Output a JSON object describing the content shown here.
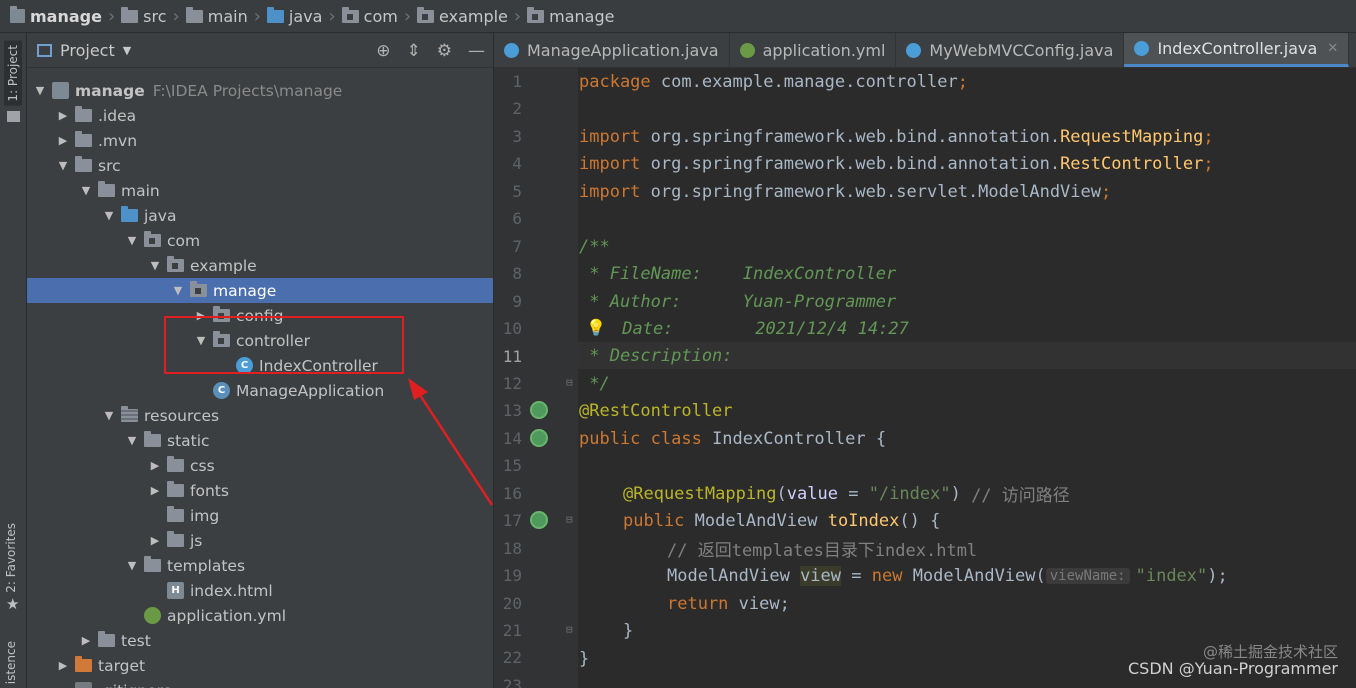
{
  "breadcrumb": [
    "manage",
    "src",
    "main",
    "java",
    "com",
    "example",
    "manage"
  ],
  "toolstrip": {
    "project_tab": "1: Project",
    "favorites_tab": "2: Favorites",
    "persistence_tab": "istence"
  },
  "project_panel": {
    "title": "Project",
    "tree": [
      {
        "label": "manage",
        "extra": "F:\\IDEA Projects\\manage",
        "depth": 0,
        "kind": "module",
        "arrow": "down"
      },
      {
        "label": ".idea",
        "depth": 1,
        "kind": "folder",
        "arrow": "right"
      },
      {
        "label": ".mvn",
        "depth": 1,
        "kind": "folder",
        "arrow": "right"
      },
      {
        "label": "src",
        "depth": 1,
        "kind": "folder",
        "arrow": "down"
      },
      {
        "label": "main",
        "depth": 2,
        "kind": "folder",
        "arrow": "down"
      },
      {
        "label": "java",
        "depth": 3,
        "kind": "folder-blue",
        "arrow": "down"
      },
      {
        "label": "com",
        "depth": 4,
        "kind": "package",
        "arrow": "down"
      },
      {
        "label": "example",
        "depth": 5,
        "kind": "package",
        "arrow": "down"
      },
      {
        "label": "manage",
        "depth": 6,
        "kind": "package",
        "arrow": "down",
        "selected": true
      },
      {
        "label": "config",
        "depth": 7,
        "kind": "package",
        "arrow": "right"
      },
      {
        "label": "controller",
        "depth": 7,
        "kind": "package",
        "arrow": "down"
      },
      {
        "label": "IndexController",
        "depth": 8,
        "kind": "class",
        "arrow": ""
      },
      {
        "label": "ManageApplication",
        "depth": 7,
        "kind": "spring-class",
        "arrow": ""
      },
      {
        "label": "resources",
        "depth": 3,
        "kind": "folder-res",
        "arrow": "down"
      },
      {
        "label": "static",
        "depth": 4,
        "kind": "folder",
        "arrow": "down"
      },
      {
        "label": "css",
        "depth": 5,
        "kind": "folder",
        "arrow": "right"
      },
      {
        "label": "fonts",
        "depth": 5,
        "kind": "folder",
        "arrow": "right"
      },
      {
        "label": "img",
        "depth": 5,
        "kind": "folder",
        "arrow": ""
      },
      {
        "label": "js",
        "depth": 5,
        "kind": "folder",
        "arrow": "right"
      },
      {
        "label": "templates",
        "depth": 4,
        "kind": "folder",
        "arrow": "down"
      },
      {
        "label": "index.html",
        "depth": 5,
        "kind": "html",
        "arrow": ""
      },
      {
        "label": "application.yml",
        "depth": 4,
        "kind": "yml",
        "arrow": ""
      },
      {
        "label": "test",
        "depth": 2,
        "kind": "folder",
        "arrow": "right"
      },
      {
        "label": "target",
        "depth": 1,
        "kind": "folder-orange",
        "arrow": "right"
      },
      {
        "label": ".gitignore",
        "depth": 1,
        "kind": "git",
        "arrow": ""
      }
    ]
  },
  "tabs": [
    {
      "label": "ManageApplication.java",
      "icon": "spring-class",
      "active": false
    },
    {
      "label": "application.yml",
      "icon": "yml",
      "active": false
    },
    {
      "label": "MyWebMVCConfig.java",
      "icon": "class",
      "active": false
    },
    {
      "label": "IndexController.java",
      "icon": "class",
      "active": true
    }
  ],
  "editor": {
    "current_line": 11,
    "line_numbers": [
      "1",
      "2",
      "3",
      "4",
      "5",
      "6",
      "7",
      "8",
      "9",
      "10",
      "11",
      "12",
      "13",
      "14",
      "15",
      "16",
      "17",
      "18",
      "19",
      "20",
      "21",
      "22",
      "23"
    ],
    "code": {
      "l1_kw": "package",
      "l1_rest": " com.example.manage.controller",
      "l1_semi": ";",
      "l3_kw": "import",
      "l3_pkg": " org.springframework.web.bind.annotation.",
      "l3_cls": "RequestMapping",
      "l3_semi": ";",
      "l4_kw": "import",
      "l4_pkg": " org.springframework.web.bind.annotation.",
      "l4_cls": "RestController",
      "l4_semi": ";",
      "l5_kw": "import",
      "l5_pkg": " org.springframework.web.servlet.ModelAndView",
      "l5_semi": ";",
      "l7": "/**",
      "l8": " * FileName:    IndexController",
      "l9": " * Author:      Yuan-Programmer",
      "l10": " Date:        2021/12/4 14:27",
      "l11": " * Description:",
      "l12": " */",
      "l13": "@RestController",
      "l14_kw": "public class",
      "l14_rest": " IndexController {",
      "l16_ann": "@RequestMapping",
      "l16_a": "(",
      "l16_param": "value",
      "l16_b": " = ",
      "l16_str": "\"/index\"",
      "l16_c": ") ",
      "l16_cmt": "// 访问路径",
      "l17_kw": "public",
      "l17_type": " ModelAndView ",
      "l17_fn": "toIndex",
      "l17_rest": "() {",
      "l18_cmt": "// 返回templates目录下index.html",
      "l19_type": "ModelAndView ",
      "l19_var": "view",
      "l19_eq": " = ",
      "l19_kw": "new",
      "l19_ctor": " ModelAndView(",
      "l19_hint": "viewName:",
      "l19_str": "\"index\"",
      "l19_end": ");",
      "l20_kw": "return",
      "l20_rest": " view;",
      "l21": "}",
      "l22": "}"
    }
  },
  "watermark": "CSDN @Yuan-Programmer",
  "watermark_cn": "@稀土掘金技术社区"
}
